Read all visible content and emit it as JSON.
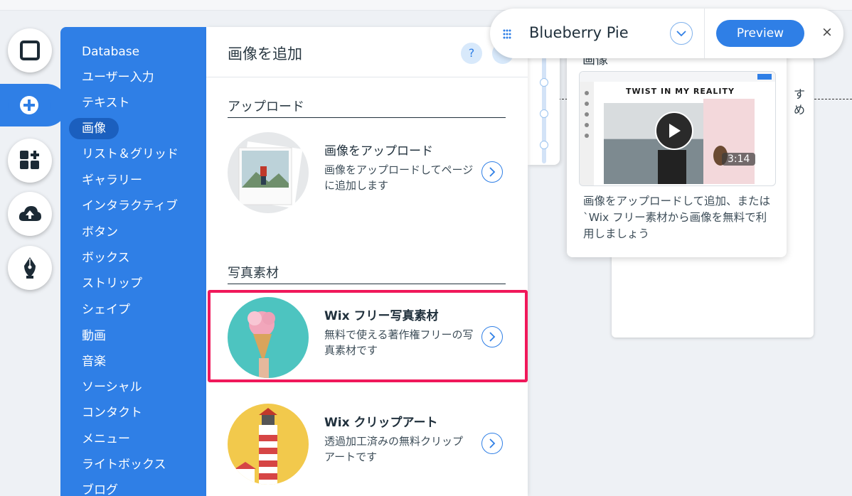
{
  "site_bar": {
    "site_name": "Blueberry Pie",
    "preview_label": "Preview",
    "close_symbol": "×"
  },
  "toolbar": {
    "items": [
      {
        "icon": "page-square-icon"
      },
      {
        "icon": "add-plus-icon",
        "active": true
      },
      {
        "icon": "add-apps-icon"
      },
      {
        "icon": "cloud-upload-icon"
      },
      {
        "icon": "pen-nib-icon"
      }
    ]
  },
  "categories": {
    "items": [
      {
        "label": "Database"
      },
      {
        "label": "ユーザー入力"
      },
      {
        "label": "テキスト"
      },
      {
        "label": "画像",
        "selected": true
      },
      {
        "label": "リスト＆グリッド"
      },
      {
        "label": "ギャラリー"
      },
      {
        "label": "インタラクティブ"
      },
      {
        "label": "ボタン"
      },
      {
        "label": "ボックス"
      },
      {
        "label": "ストリップ"
      },
      {
        "label": "シェイプ"
      },
      {
        "label": "動画"
      },
      {
        "label": "音楽"
      },
      {
        "label": "ソーシャル"
      },
      {
        "label": "コンタクト"
      },
      {
        "label": "メニュー"
      },
      {
        "label": "ライトボックス"
      },
      {
        "label": "ブログ"
      }
    ]
  },
  "panel": {
    "title": "画像を追加",
    "help_label": "?",
    "sections": {
      "upload": {
        "label": "アップロード",
        "item": {
          "title": "画像をアップロード",
          "desc": "画像をアップロードしてページに追加します"
        }
      },
      "stock": {
        "label": "写真素材",
        "free_photos": {
          "title": "Wix フリー写真素材",
          "desc": "無料で使える著作権フリーの写真素材です"
        },
        "clipart": {
          "title": "Wix クリップアート",
          "desc": "透過加工済みの無料クリップアートです"
        }
      }
    }
  },
  "tooltip": {
    "title": "画像",
    "video_caption": "TWIST IN MY REALITY",
    "duration": "3:14",
    "desc": "画像をアップロードして追加、または `Wix フリー素材から画像を無料で利用しましょう"
  },
  "background_card": {
    "text_line1": "す",
    "text_line2": "め"
  },
  "colors": {
    "accent": "#2f7fe6",
    "highlight": "#f0185a"
  }
}
